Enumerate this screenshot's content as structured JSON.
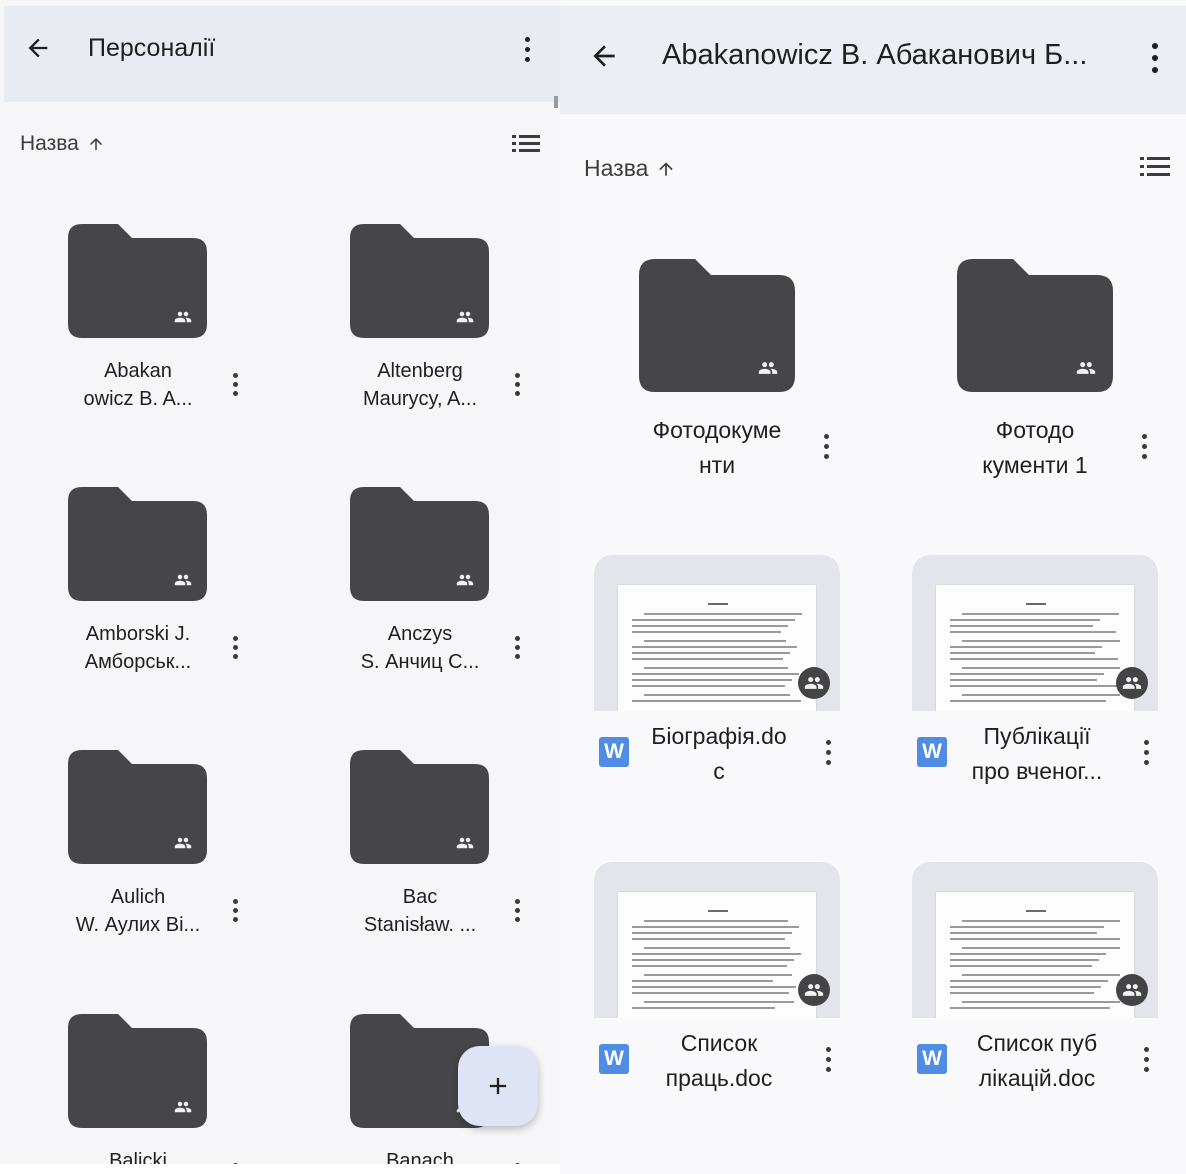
{
  "left_panel": {
    "title": "Персоналії",
    "sort_label": "Назва",
    "folders": [
      {
        "name_line1": "Abakan",
        "name_line2": "owicz B. A..."
      },
      {
        "name_line1": "Altenberg",
        "name_line2": "Maurycy, A..."
      },
      {
        "name_line1": "Amborski J.",
        "name_line2": "Амборськ..."
      },
      {
        "name_line1": "Anczys",
        "name_line2": "S. Анчиц С..."
      },
      {
        "name_line1": "Aulich",
        "name_line2": "W. Аулих Ві..."
      },
      {
        "name_line1": "Bac",
        "name_line2": "Stanisław. ..."
      },
      {
        "name_line1": "Balicki",
        "name_line2": ""
      },
      {
        "name_line1": "Banach",
        "name_line2": ""
      }
    ],
    "fab_label": "+"
  },
  "right_panel": {
    "title": "Abakanowicz B. Абаканович Б...",
    "sort_label": "Назва",
    "folders": [
      {
        "name_line1": "Фотодокуме",
        "name_line2": "нти"
      },
      {
        "name_line1": "Фотодо",
        "name_line2": "кументи 1"
      }
    ],
    "files": [
      {
        "name_line1": "Біографія.do",
        "name_line2": "c",
        "type_icon": "W"
      },
      {
        "name_line1": "Публікації",
        "name_line2": "про вченог...",
        "type_icon": "W"
      },
      {
        "name_line1": "Список",
        "name_line2": "праць.doc",
        "type_icon": "W"
      },
      {
        "name_line1": "Список пуб",
        "name_line2": "лікацій.doc",
        "type_icon": "W"
      }
    ]
  },
  "colors": {
    "folder": "#45454a",
    "topbar": "#e9ebf3",
    "word": "#4e8de3",
    "fab": "#dfe3f6"
  },
  "icons": {
    "back": "arrow-back-icon",
    "more": "more-vert-icon",
    "sort": "arrow-up-icon",
    "view": "list-view-icon",
    "shared": "shared-people-icon",
    "add": "plus-icon"
  }
}
